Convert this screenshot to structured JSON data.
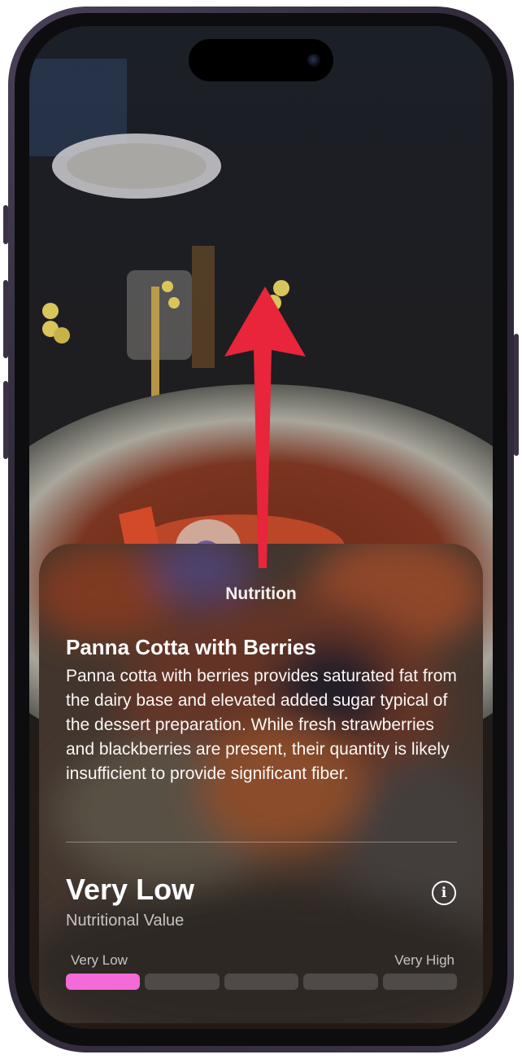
{
  "card": {
    "title": "Nutrition",
    "dish_name": "Panna Cotta with Berries",
    "description": "Panna cotta with berries provides saturated fat from the dairy base and elevated added sugar typical of the dessert preparation. While fresh strawberries and blackberries are present, their quantity is likely insufficient to provide significant fiber.",
    "rating": "Very Low",
    "rating_label": "Nutritional Value",
    "scale": {
      "low_label": "Very Low",
      "high_label": "Very High",
      "segments": 5,
      "active_segment": 1
    }
  },
  "colors": {
    "accent_segment": "#f36ad8",
    "arrow": "#e8253b"
  },
  "icons": {
    "info": "info-circle-icon",
    "arrow": "swipe-up-arrow"
  }
}
